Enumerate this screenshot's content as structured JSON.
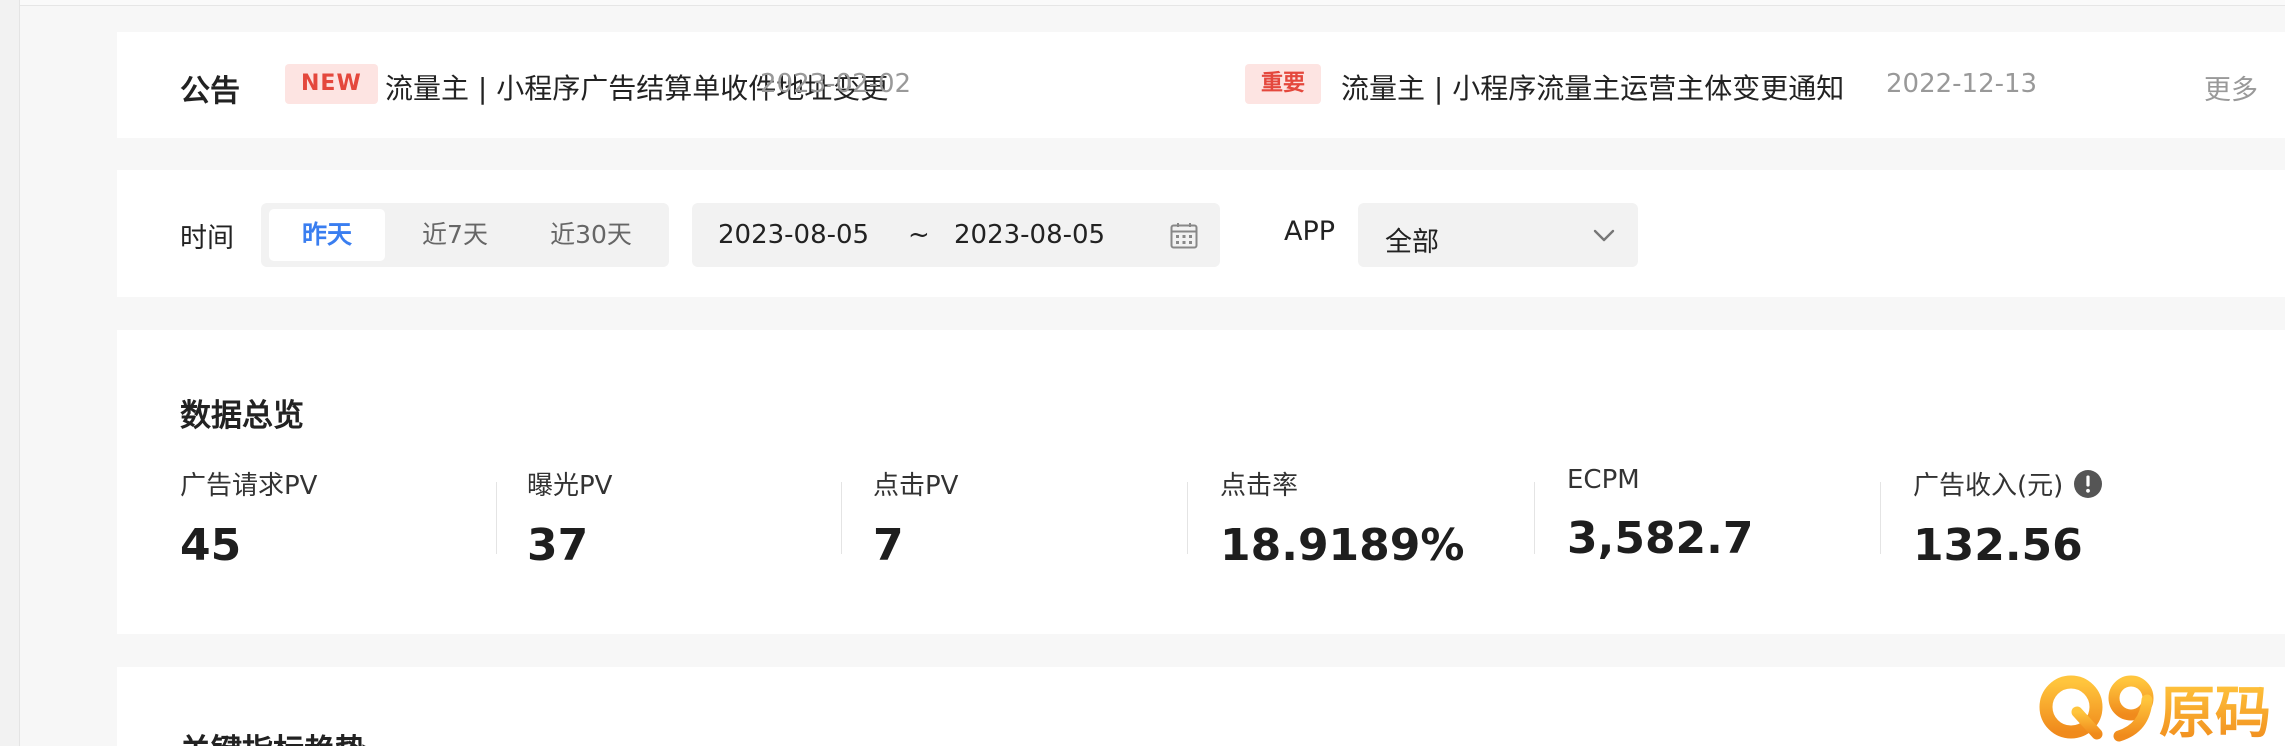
{
  "notice": {
    "title": "公告",
    "items": [
      {
        "tag": "NEW",
        "text": "流量主 | 小程序广告结算单收件地址变更",
        "date": "2023-02-02"
      },
      {
        "tag": "重要",
        "text": "流量主 | 小程序流量主运营主体变更通知",
        "date": "2022-12-13"
      }
    ],
    "more_label": "更多"
  },
  "filter": {
    "time_label": "时间",
    "segments": [
      "昨天",
      "近7天",
      "近30天"
    ],
    "active_segment": "昨天",
    "date_start": "2023-08-05",
    "date_sep": "~",
    "date_end": "2023-08-05",
    "app_label": "APP",
    "app_value": "全部"
  },
  "overview": {
    "title": "数据总览",
    "metrics": [
      {
        "label": "广告请求PV",
        "value": "45"
      },
      {
        "label": "曝光PV",
        "value": "37"
      },
      {
        "label": "点击PV",
        "value": "7"
      },
      {
        "label": "点击率",
        "value": "18.9189%"
      },
      {
        "label": "ECPM",
        "value": "3,582.7"
      },
      {
        "label": "广告收入(元)",
        "value": "132.56"
      }
    ]
  },
  "trend": {
    "title": "关键指标趋势"
  },
  "watermark": {
    "text": "Q9原码"
  },
  "colors": {
    "accent": "#3a7ef0",
    "tag_bg": "#fde4e2",
    "tag_fg": "#e4483d",
    "muted": "#999999",
    "watermark": "#f5a623"
  },
  "icons": [
    "calendar-icon",
    "chevron-down-icon",
    "info-icon"
  ]
}
